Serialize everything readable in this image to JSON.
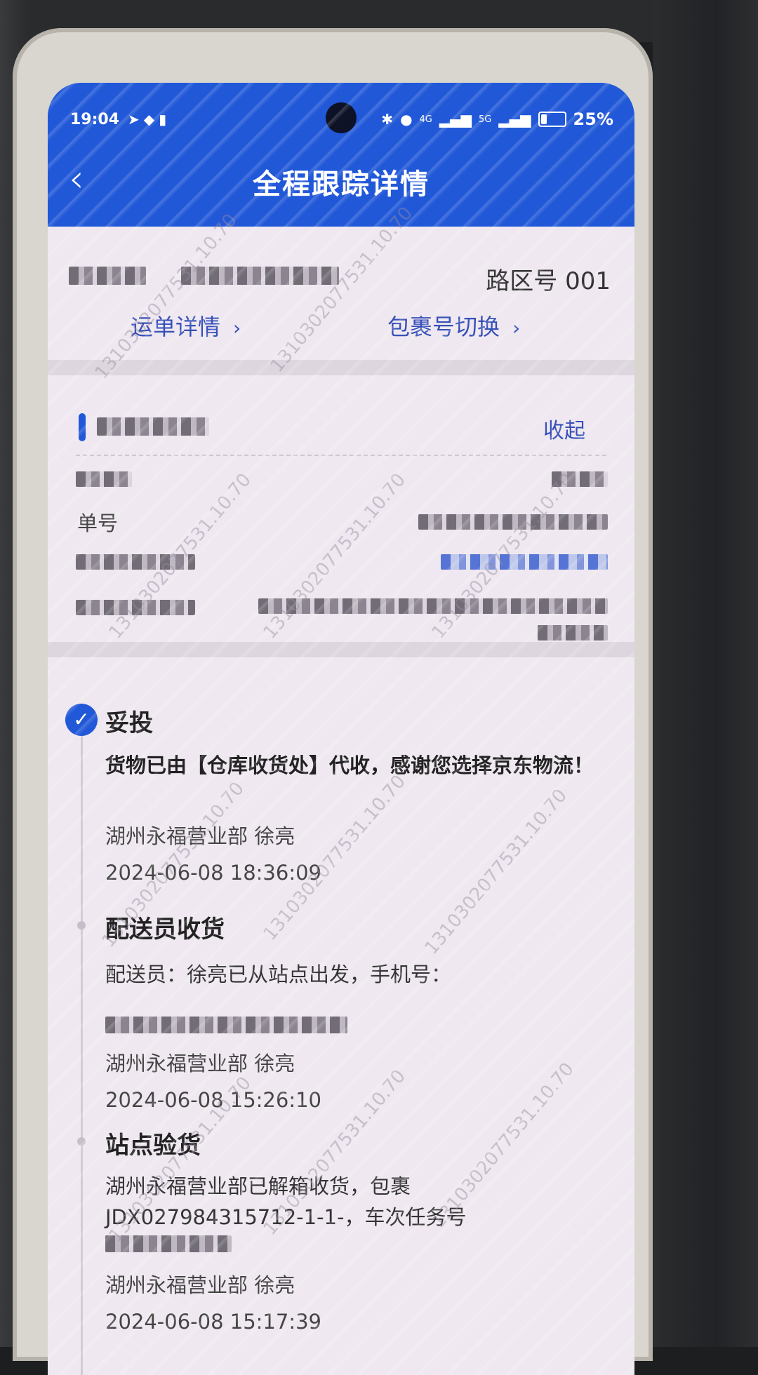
{
  "status_bar": {
    "time": "19:04",
    "battery": "25%",
    "battery_level": 0.25,
    "net1": "4G",
    "net2": "5G"
  },
  "header": {
    "back_icon": "chevron-left-icon",
    "title": "全程跟踪详情"
  },
  "summary": {
    "zone": "路区号 001",
    "waybill_link": "运单详情",
    "switch_link": "包裹号切换",
    "chevron": "›"
  },
  "details": {
    "collapse": "收起",
    "order_label": "单号"
  },
  "watermark": [
    "1310302077531.10.70"
  ],
  "events": [
    {
      "title": "妥投",
      "desc": "货物已由【仓库收货处】代收，感谢您选择京东物流！",
      "operator": "湖州永福营业部  徐亮",
      "time": "2024-06-08 18:36:09",
      "done": true
    },
    {
      "title": "配送员收货",
      "desc": "配送员：徐亮已从站点出发，手机号：",
      "operator": "湖州永福营业部  徐亮",
      "time": "2024-06-08 15:26:10",
      "done": false
    },
    {
      "title": "站点验货",
      "desc": "湖州永福营业部已解箱收货，包裹JDX027984315712-1-1-，车次任务号",
      "operator": "湖州永福营业部  徐亮",
      "time": "2024-06-08 15:17:39",
      "done": false
    }
  ]
}
